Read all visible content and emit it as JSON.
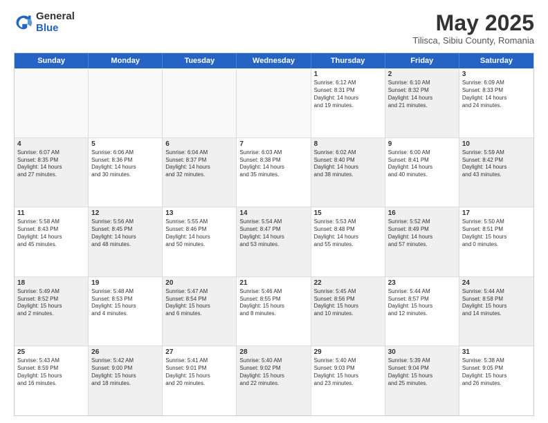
{
  "logo": {
    "general": "General",
    "blue": "Blue"
  },
  "title": "May 2025",
  "subtitle": "Tilisca, Sibiu County, Romania",
  "header_days": [
    "Sunday",
    "Monday",
    "Tuesday",
    "Wednesday",
    "Thursday",
    "Friday",
    "Saturday"
  ],
  "weeks": [
    [
      {
        "day": "",
        "text": "",
        "shaded": false,
        "empty": true
      },
      {
        "day": "",
        "text": "",
        "shaded": false,
        "empty": true
      },
      {
        "day": "",
        "text": "",
        "shaded": false,
        "empty": true
      },
      {
        "day": "",
        "text": "",
        "shaded": false,
        "empty": true
      },
      {
        "day": "1",
        "text": "Sunrise: 6:12 AM\nSunset: 8:31 PM\nDaylight: 14 hours\nand 19 minutes.",
        "shaded": false,
        "empty": false
      },
      {
        "day": "2",
        "text": "Sunrise: 6:10 AM\nSunset: 8:32 PM\nDaylight: 14 hours\nand 21 minutes.",
        "shaded": true,
        "empty": false
      },
      {
        "day": "3",
        "text": "Sunrise: 6:09 AM\nSunset: 8:33 PM\nDaylight: 14 hours\nand 24 minutes.",
        "shaded": false,
        "empty": false
      }
    ],
    [
      {
        "day": "4",
        "text": "Sunrise: 6:07 AM\nSunset: 8:35 PM\nDaylight: 14 hours\nand 27 minutes.",
        "shaded": true,
        "empty": false
      },
      {
        "day": "5",
        "text": "Sunrise: 6:06 AM\nSunset: 8:36 PM\nDaylight: 14 hours\nand 30 minutes.",
        "shaded": false,
        "empty": false
      },
      {
        "day": "6",
        "text": "Sunrise: 6:04 AM\nSunset: 8:37 PM\nDaylight: 14 hours\nand 32 minutes.",
        "shaded": true,
        "empty": false
      },
      {
        "day": "7",
        "text": "Sunrise: 6:03 AM\nSunset: 8:38 PM\nDaylight: 14 hours\nand 35 minutes.",
        "shaded": false,
        "empty": false
      },
      {
        "day": "8",
        "text": "Sunrise: 6:02 AM\nSunset: 8:40 PM\nDaylight: 14 hours\nand 38 minutes.",
        "shaded": true,
        "empty": false
      },
      {
        "day": "9",
        "text": "Sunrise: 6:00 AM\nSunset: 8:41 PM\nDaylight: 14 hours\nand 40 minutes.",
        "shaded": false,
        "empty": false
      },
      {
        "day": "10",
        "text": "Sunrise: 5:59 AM\nSunset: 8:42 PM\nDaylight: 14 hours\nand 43 minutes.",
        "shaded": true,
        "empty": false
      }
    ],
    [
      {
        "day": "11",
        "text": "Sunrise: 5:58 AM\nSunset: 8:43 PM\nDaylight: 14 hours\nand 45 minutes.",
        "shaded": false,
        "empty": false
      },
      {
        "day": "12",
        "text": "Sunrise: 5:56 AM\nSunset: 8:45 PM\nDaylight: 14 hours\nand 48 minutes.",
        "shaded": true,
        "empty": false
      },
      {
        "day": "13",
        "text": "Sunrise: 5:55 AM\nSunset: 8:46 PM\nDaylight: 14 hours\nand 50 minutes.",
        "shaded": false,
        "empty": false
      },
      {
        "day": "14",
        "text": "Sunrise: 5:54 AM\nSunset: 8:47 PM\nDaylight: 14 hours\nand 53 minutes.",
        "shaded": true,
        "empty": false
      },
      {
        "day": "15",
        "text": "Sunrise: 5:53 AM\nSunset: 8:48 PM\nDaylight: 14 hours\nand 55 minutes.",
        "shaded": false,
        "empty": false
      },
      {
        "day": "16",
        "text": "Sunrise: 5:52 AM\nSunset: 8:49 PM\nDaylight: 14 hours\nand 57 minutes.",
        "shaded": true,
        "empty": false
      },
      {
        "day": "17",
        "text": "Sunrise: 5:50 AM\nSunset: 8:51 PM\nDaylight: 15 hours\nand 0 minutes.",
        "shaded": false,
        "empty": false
      }
    ],
    [
      {
        "day": "18",
        "text": "Sunrise: 5:49 AM\nSunset: 8:52 PM\nDaylight: 15 hours\nand 2 minutes.",
        "shaded": true,
        "empty": false
      },
      {
        "day": "19",
        "text": "Sunrise: 5:48 AM\nSunset: 8:53 PM\nDaylight: 15 hours\nand 4 minutes.",
        "shaded": false,
        "empty": false
      },
      {
        "day": "20",
        "text": "Sunrise: 5:47 AM\nSunset: 8:54 PM\nDaylight: 15 hours\nand 6 minutes.",
        "shaded": true,
        "empty": false
      },
      {
        "day": "21",
        "text": "Sunrise: 5:46 AM\nSunset: 8:55 PM\nDaylight: 15 hours\nand 8 minutes.",
        "shaded": false,
        "empty": false
      },
      {
        "day": "22",
        "text": "Sunrise: 5:45 AM\nSunset: 8:56 PM\nDaylight: 15 hours\nand 10 minutes.",
        "shaded": true,
        "empty": false
      },
      {
        "day": "23",
        "text": "Sunrise: 5:44 AM\nSunset: 8:57 PM\nDaylight: 15 hours\nand 12 minutes.",
        "shaded": false,
        "empty": false
      },
      {
        "day": "24",
        "text": "Sunrise: 5:44 AM\nSunset: 8:58 PM\nDaylight: 15 hours\nand 14 minutes.",
        "shaded": true,
        "empty": false
      }
    ],
    [
      {
        "day": "25",
        "text": "Sunrise: 5:43 AM\nSunset: 8:59 PM\nDaylight: 15 hours\nand 16 minutes.",
        "shaded": false,
        "empty": false
      },
      {
        "day": "26",
        "text": "Sunrise: 5:42 AM\nSunset: 9:00 PM\nDaylight: 15 hours\nand 18 minutes.",
        "shaded": true,
        "empty": false
      },
      {
        "day": "27",
        "text": "Sunrise: 5:41 AM\nSunset: 9:01 PM\nDaylight: 15 hours\nand 20 minutes.",
        "shaded": false,
        "empty": false
      },
      {
        "day": "28",
        "text": "Sunrise: 5:40 AM\nSunset: 9:02 PM\nDaylight: 15 hours\nand 22 minutes.",
        "shaded": true,
        "empty": false
      },
      {
        "day": "29",
        "text": "Sunrise: 5:40 AM\nSunset: 9:03 PM\nDaylight: 15 hours\nand 23 minutes.",
        "shaded": false,
        "empty": false
      },
      {
        "day": "30",
        "text": "Sunrise: 5:39 AM\nSunset: 9:04 PM\nDaylight: 15 hours\nand 25 minutes.",
        "shaded": true,
        "empty": false
      },
      {
        "day": "31",
        "text": "Sunrise: 5:38 AM\nSunset: 9:05 PM\nDaylight: 15 hours\nand 26 minutes.",
        "shaded": false,
        "empty": false
      }
    ]
  ]
}
